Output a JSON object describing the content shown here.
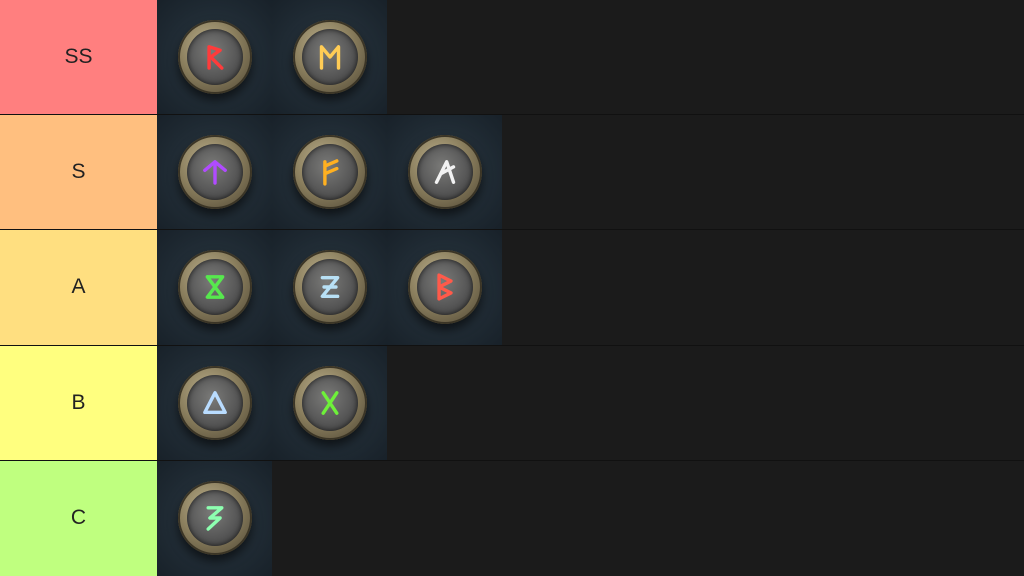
{
  "tiers": [
    {
      "label": "SS",
      "color": "#ff7f7f",
      "items": [
        {
          "name": "red-rune-icon",
          "color": "#ff3b3b",
          "glyph": "R"
        },
        {
          "name": "gold-rune-icon",
          "color": "#ffcc55",
          "glyph": "M"
        }
      ]
    },
    {
      "label": "S",
      "color": "#ffbf7f",
      "items": [
        {
          "name": "purple-rune-icon",
          "color": "#b04bff",
          "glyph": "T"
        },
        {
          "name": "orange-rune-icon",
          "color": "#ffb020",
          "glyph": "F"
        },
        {
          "name": "white-rune-icon",
          "color": "#f2f2f2",
          "glyph": "A"
        }
      ]
    },
    {
      "label": "A",
      "color": "#ffdf80",
      "items": [
        {
          "name": "green-rune-icon",
          "color": "#57e84e",
          "glyph": "X"
        },
        {
          "name": "pale-blue-rune-icon",
          "color": "#b8e0f5",
          "glyph": "Z"
        },
        {
          "name": "coral-rune-icon",
          "color": "#ff5a4a",
          "glyph": "B"
        }
      ]
    },
    {
      "label": "B",
      "color": "#ffff7f",
      "items": [
        {
          "name": "light-blue-rune-icon",
          "color": "#b9dcff",
          "glyph": "D"
        },
        {
          "name": "lime-rune-icon",
          "color": "#6ef03a",
          "glyph": "X"
        }
      ]
    },
    {
      "label": "C",
      "color": "#bfff7f",
      "items": [
        {
          "name": "mint-rune-icon",
          "color": "#8dffb0",
          "glyph": "S"
        }
      ]
    }
  ]
}
